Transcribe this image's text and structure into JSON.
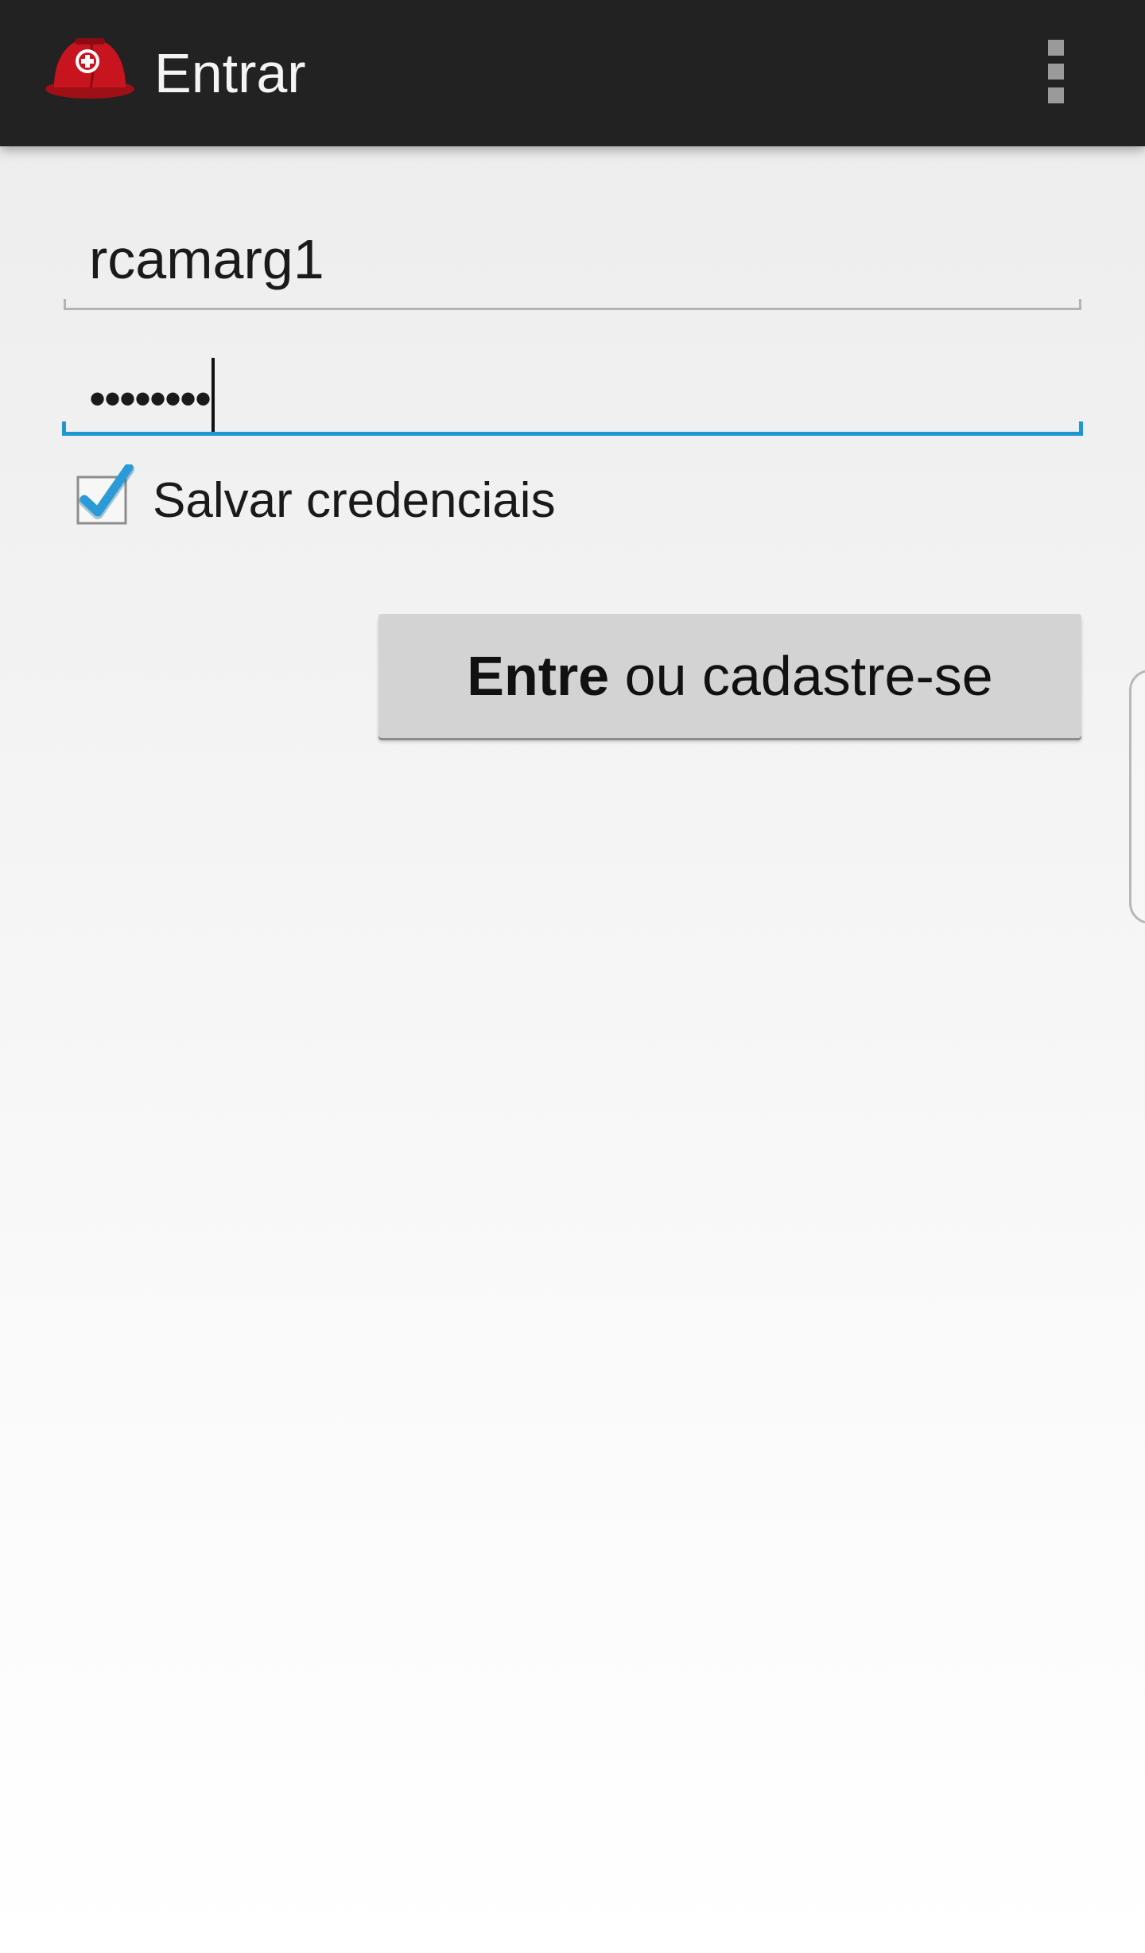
{
  "action_bar": {
    "title": "Entrar",
    "app_icon": "firefighter-helmet-icon",
    "menu_icon": "overflow-menu-icon"
  },
  "login_form": {
    "username": {
      "value": "rcamarg1"
    },
    "password": {
      "masked_value": "••••••••"
    },
    "save_credentials": {
      "label": "Salvar credenciais",
      "checked": true
    },
    "submit_button": {
      "label_bold": "Entre",
      "label_rest": " ou cadastre-se"
    }
  },
  "edge_panel": {
    "icon": "edge-panel-handle"
  },
  "colors": {
    "action_bar": "#222222",
    "accent": "#1e96d2",
    "helmet_red": "#c8141e",
    "button": "#d3d3d3"
  }
}
